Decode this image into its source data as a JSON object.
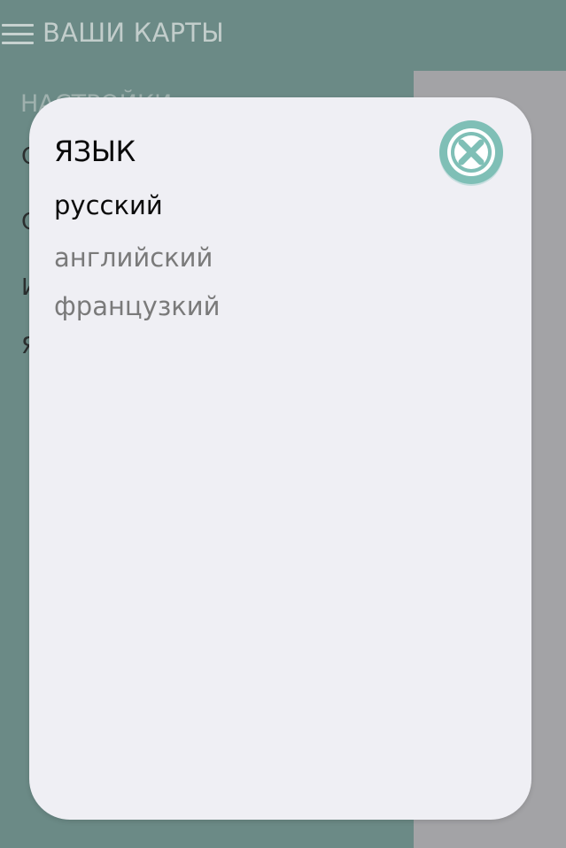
{
  "header": {
    "title": "ВАШИ КАРТЫ"
  },
  "sidebar": {
    "heading": "НАСТРОЙКИ",
    "items": [
      {
        "label": "С"
      },
      {
        "label": "С"
      },
      {
        "label": "И"
      },
      {
        "label": "Я"
      }
    ]
  },
  "dialog": {
    "title": "ЯЗЫК",
    "options": [
      {
        "label": "русский",
        "selected": true
      },
      {
        "label": "английский",
        "selected": false
      },
      {
        "label": "французкий",
        "selected": false
      }
    ],
    "close_icon": "close-circle-icon"
  },
  "colors": {
    "header_bg": "#6b8a86",
    "dialog_bg": "#efeff4",
    "accent_teal": "#7fbfb6",
    "overlay_gray": "#a3a3a6"
  }
}
